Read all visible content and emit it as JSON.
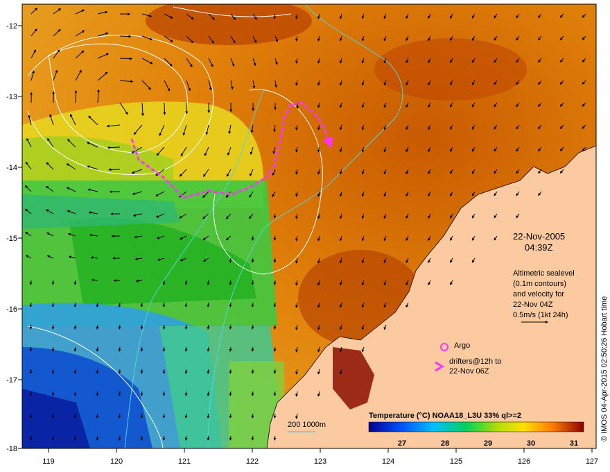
{
  "map": {
    "date": "22-Nov-2005",
    "time": "04:39Z",
    "altimetry_note": [
      "Altimetric sealevel",
      "(0.1m contours)",
      "and velocity for",
      "22-Nov 04Z",
      "0.5m/s (1kt 24h)"
    ],
    "argo_label": "Argo",
    "drifters_label": [
      "drifters@12h to",
      "22-Nov 06Z"
    ],
    "bathy_label": "200  1000m",
    "colorbar_title": "Temperature (°C) NOAA18_L3U 33% ql>=2",
    "colorbar_ticks": [
      "27",
      "28",
      "29",
      "30",
      "31"
    ],
    "x_ticks": [
      "119",
      "120",
      "121",
      "122",
      "123",
      "124",
      "125",
      "126",
      "127"
    ],
    "y_ticks": [
      "-12",
      "-13",
      "-14",
      "-15",
      "-16",
      "-17",
      "-18"
    ],
    "credit": "© IMOS 04-Apr-2015 02:50:26 Hobart time",
    "colors": {
      "land": "#fbcaa0",
      "drifter": "#ff33ff",
      "bathy_contour": "#4fd6d6",
      "sealevel_contour": "#ffffff"
    }
  }
}
